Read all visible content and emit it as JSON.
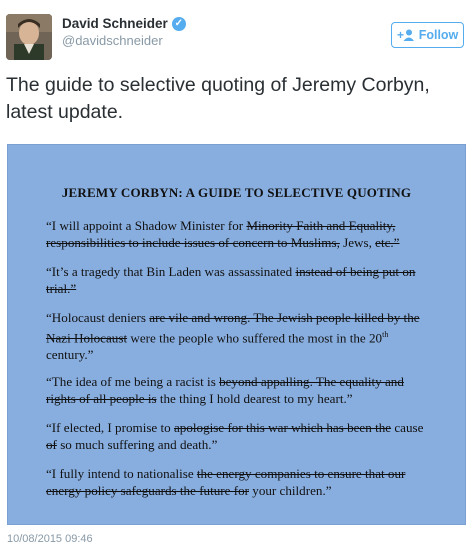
{
  "tweet": {
    "author_name": "David Schneider",
    "handle": "@davidschneider",
    "follow_label": "Follow",
    "text": "The guide to selective quoting of Jeremy Corbyn, latest update.",
    "timestamp": "10/08/2015 09:46"
  },
  "image": {
    "title": "JEREMY CORBYN: A GUIDE TO SELECTIVE QUOTING",
    "quotes": [
      {
        "a": "“I will appoint a Shadow Minister for ",
        "s1": "Minority Faith and Equality, responsibilities to include issues of concern to Muslims,",
        "b": " Jews, ",
        "s2": "etc.”"
      },
      {
        "a": "“It’s a tragedy that Bin Laden was assassinated ",
        "s1": "instead of being put on trial.”"
      },
      {
        "a": "“Holocaust deniers ",
        "s1": "are vile and wrong. The Jewish people killed by the Nazi Holocaust",
        "b": " were the people who suffered the most in the 20",
        "sup": "th",
        "c": " century.”"
      },
      {
        "a": "“The idea of me being a racist is ",
        "s1": "beyond appalling. The equality and rights of all people is",
        "b": " the thing I hold dearest to my heart.”"
      },
      {
        "a": "“If elected, I promise to ",
        "s1": "apologise for this war which has been the",
        "b": " cause ",
        "s2": "of",
        "c": " so much suffering and death.”"
      },
      {
        "a": " “I fully intend to nationalise ",
        "s1": "the energy companies to ensure that our energy policy safeguards the future for",
        "b": " your children.”"
      }
    ]
  },
  "colors": {
    "image_background": "#88aee0",
    "follow_blue": "#55acee",
    "verified_blue": "#55acee"
  },
  "icons": [
    "verified-badge-icon",
    "follow-person-icon"
  ]
}
